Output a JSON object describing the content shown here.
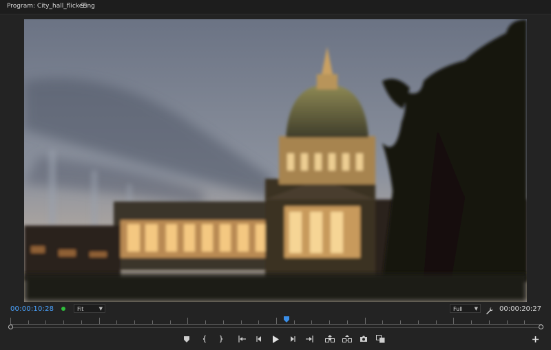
{
  "panel": {
    "title": "Program: City_hall_flickering"
  },
  "viewer": {
    "content": "city-hall-dusk-blurred-footage"
  },
  "controls": {
    "current_timecode": "00:00:10:28",
    "zoom_value": "Fit",
    "resolution_value": "Full",
    "duration_timecode": "00:00:20:27"
  },
  "playback": {
    "playhead_fraction": 0.52
  },
  "colors": {
    "timecode_accent": "#4aa3ff",
    "status_green": "#2fbf3b",
    "panel_bg": "#232323",
    "playhead": "#3a8ee8"
  },
  "icons": {
    "transport": [
      "add-marker-icon",
      "mark-in-icon",
      "mark-out-icon",
      "go-to-in-icon",
      "step-back-icon",
      "play-icon",
      "step-forward-icon",
      "go-to-out-icon",
      "lift-icon",
      "extract-icon",
      "export-frame-icon",
      "comparison-view-icon"
    ],
    "add_button": "plus-icon"
  }
}
